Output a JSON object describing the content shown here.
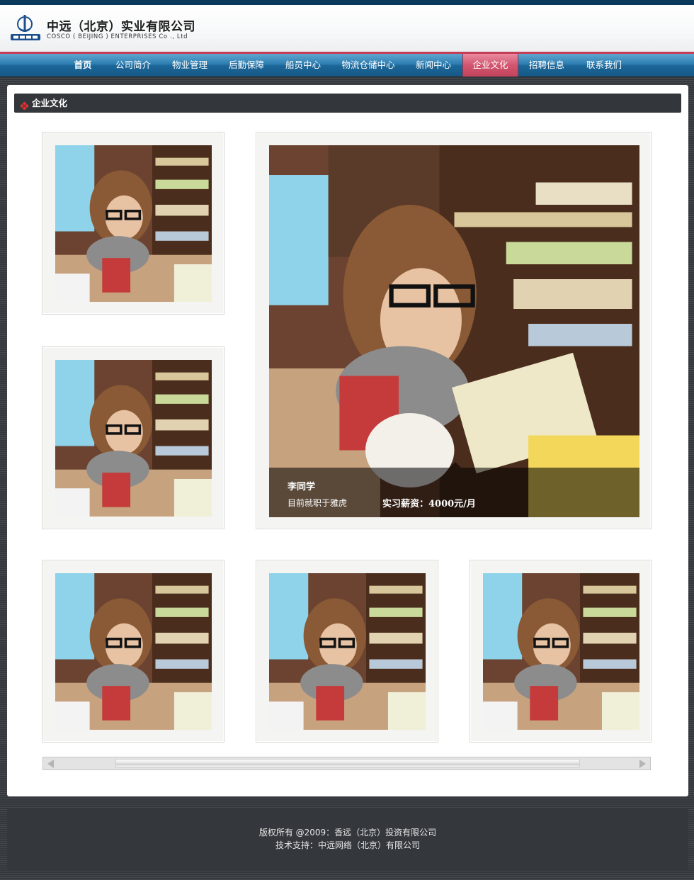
{
  "header": {
    "company_name_cn": "中远（北京）实业有限公司",
    "company_name_en": "COSCO ( BEIJING ) ENTERPRISES Co ., Ltd",
    "logo_icon": "cosco-logo-icon"
  },
  "nav": {
    "items": [
      {
        "label": "首页"
      },
      {
        "label": "公司简介"
      },
      {
        "label": "物业管理"
      },
      {
        "label": "后勤保障"
      },
      {
        "label": "船员中心"
      },
      {
        "label": "物流仓储中心"
      },
      {
        "label": "新闻中心"
      },
      {
        "label": "企业文化"
      },
      {
        "label": "招聘信息"
      },
      {
        "label": "联系我们"
      }
    ],
    "active_label": "企业文化"
  },
  "section": {
    "title": "企业文化",
    "icon": "red-diamond-bullet-icon"
  },
  "featured": {
    "name": "李同学",
    "description": "目前就职于雅虎",
    "salary": "实习薪资：4000元/月"
  },
  "footer": {
    "copyright": "版权所有 @2009：香远（北京）投资有限公司",
    "support": "技术支持：中远网络（北京）有限公司"
  },
  "colors": {
    "nav_blue": "#1b6698",
    "nav_active": "#d2566f",
    "header_stripe": "#0b3a5c",
    "section_bar": "#33373c"
  }
}
